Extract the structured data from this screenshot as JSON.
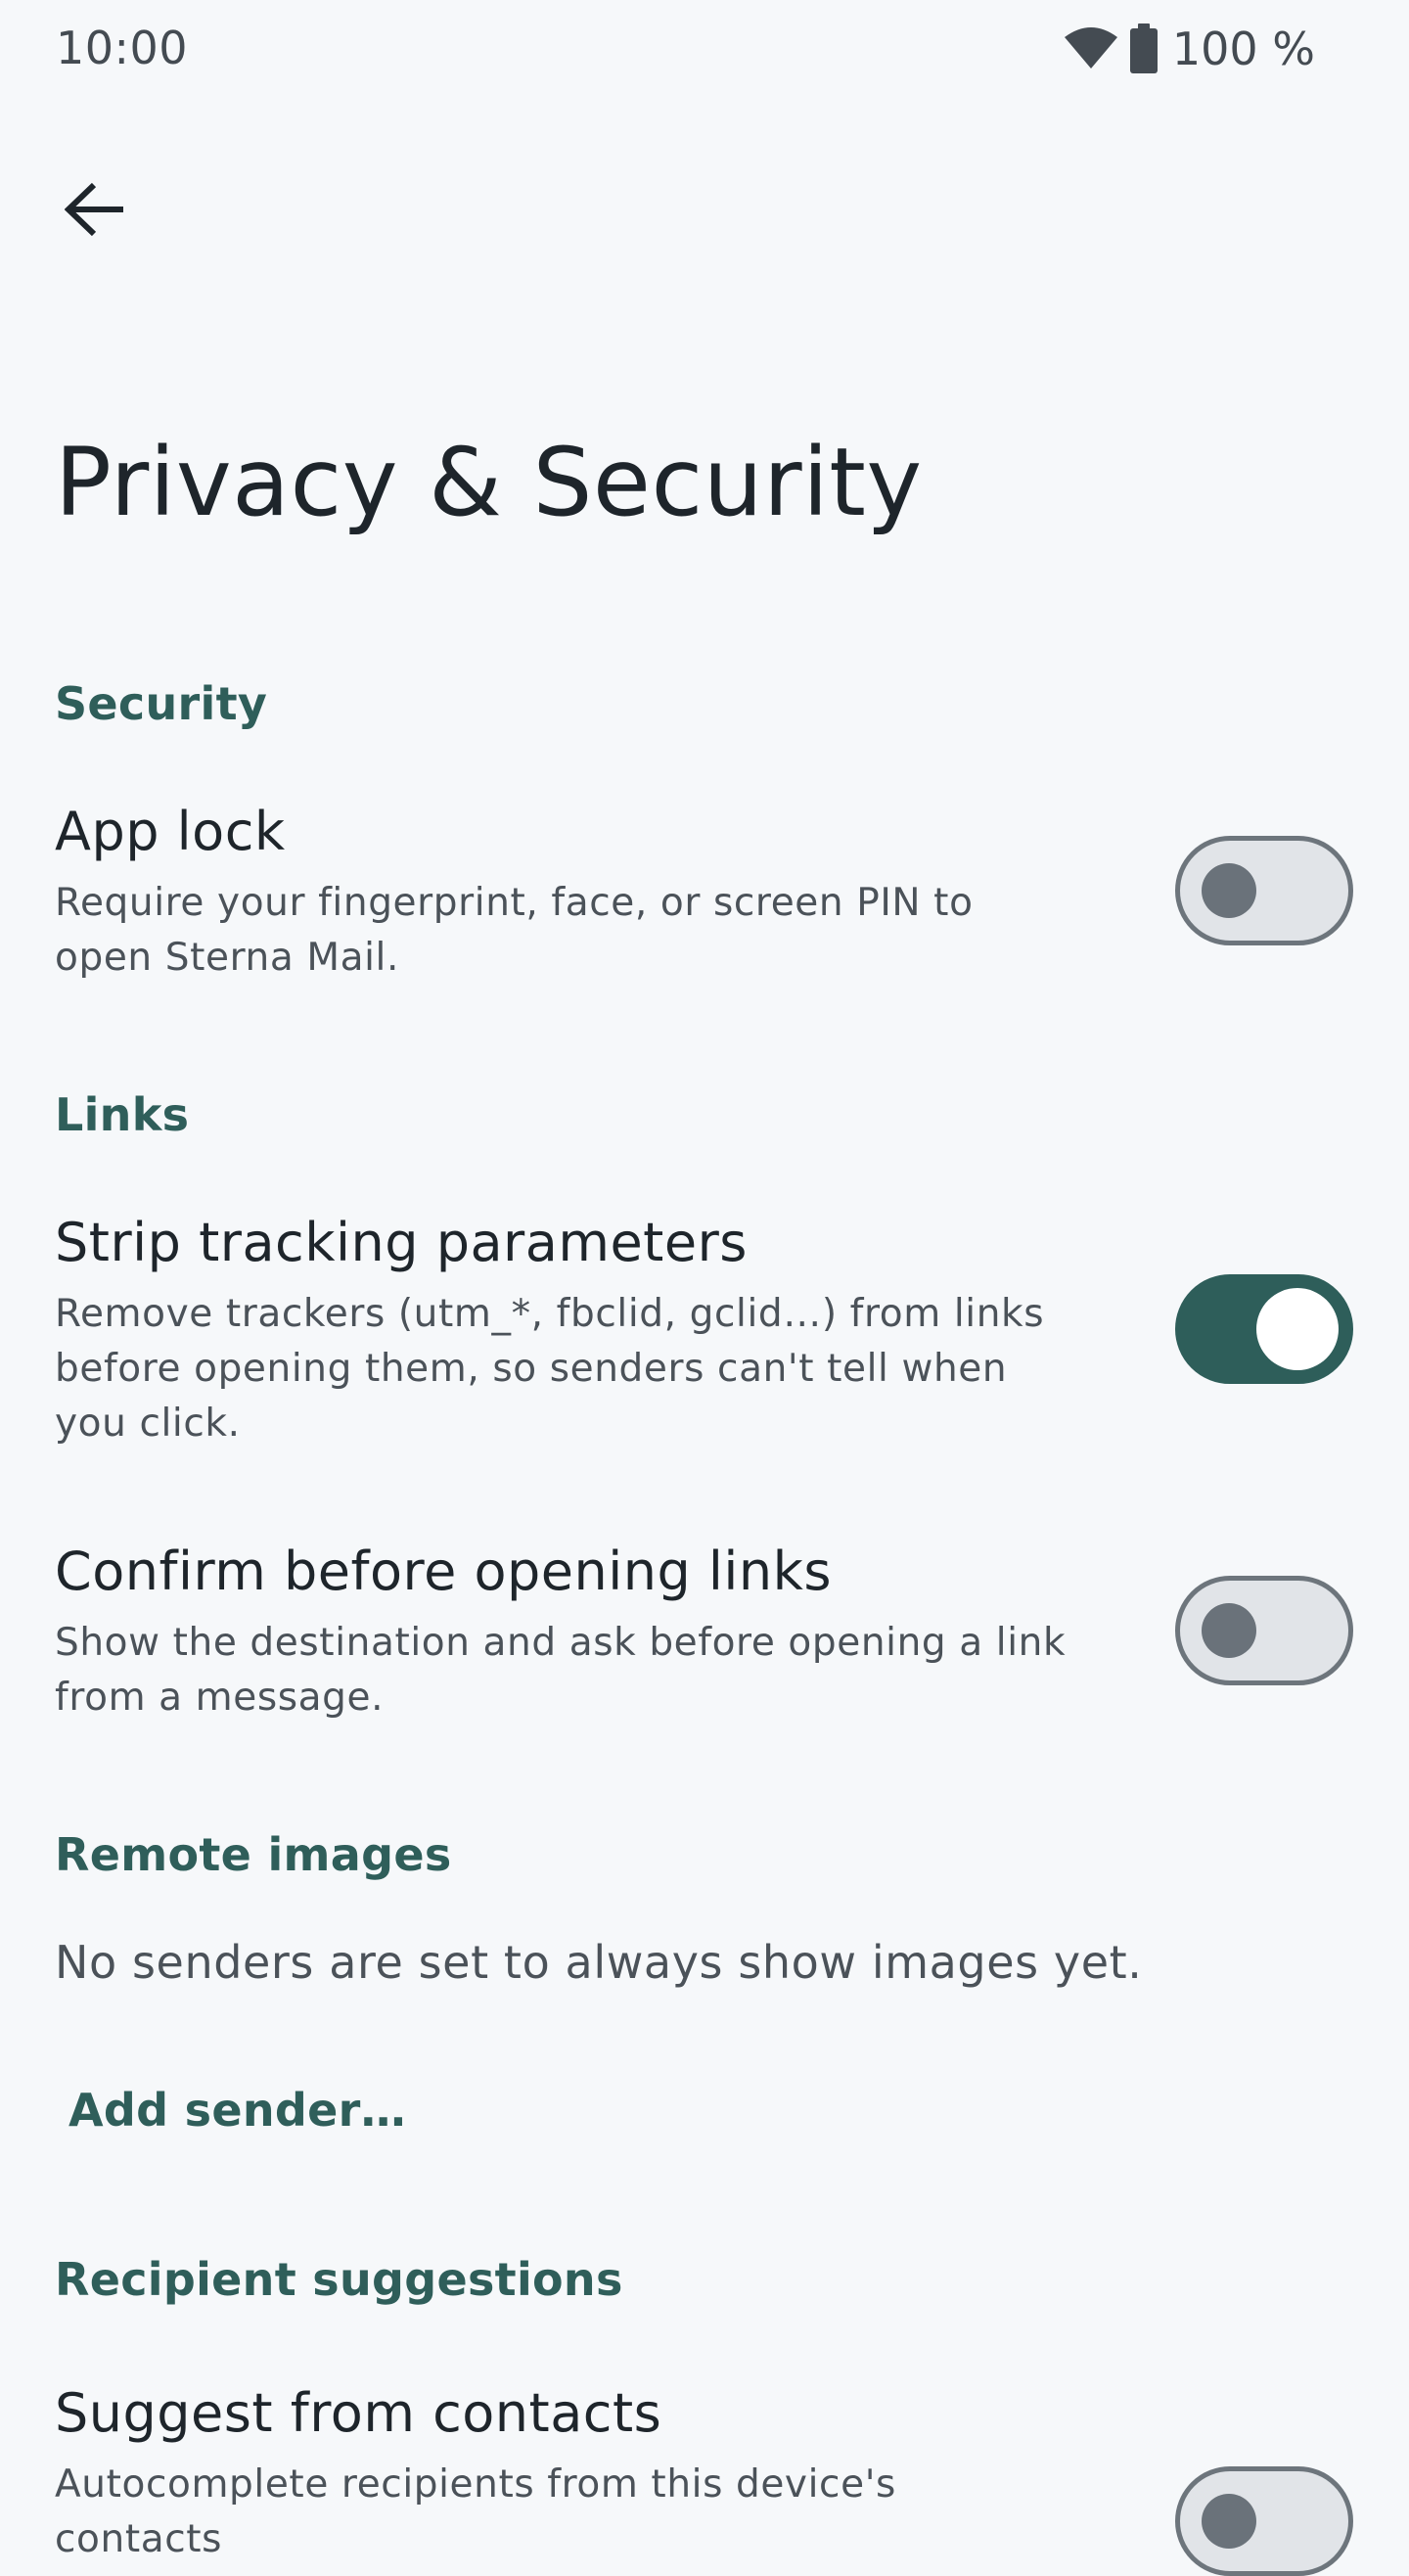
{
  "status_bar": {
    "time": "10:00",
    "battery": "100 %",
    "icons": [
      "wifi-icon",
      "battery-icon"
    ]
  },
  "top_bar": {
    "back_icon": "arrow-back-icon"
  },
  "page": {
    "title": "Privacy & Security"
  },
  "sections": {
    "security": {
      "header": "Security",
      "app_lock": {
        "title": "App lock",
        "description": "Require your fingerprint, face, or screen PIN to open Sterna Mail.",
        "enabled": false
      }
    },
    "links": {
      "header": "Links",
      "strip_tracking": {
        "title": "Strip tracking parameters",
        "description": "Remove trackers (utm_*, fbclid, gclid…) from links before opening them, so senders can't tell when you click.",
        "enabled": true
      },
      "confirm_links": {
        "title": "Confirm before opening links",
        "description": "Show the destination and ask before opening a link from a message.",
        "enabled": false
      }
    },
    "remote_images": {
      "header": "Remote images",
      "empty_text": "No senders are set to always show images yet.",
      "add_sender_label": "Add sender…"
    },
    "recipient_suggestions": {
      "header": "Recipient suggestions",
      "suggest_contacts": {
        "title": "Suggest from contacts",
        "description": "Autocomplete recipients from this device's contacts",
        "enabled": false
      }
    }
  },
  "colors": {
    "background": "#F6F8FA",
    "accent": "#2F5E5A",
    "text_primary": "#1E252B",
    "text_secondary": "#4B5259"
  }
}
